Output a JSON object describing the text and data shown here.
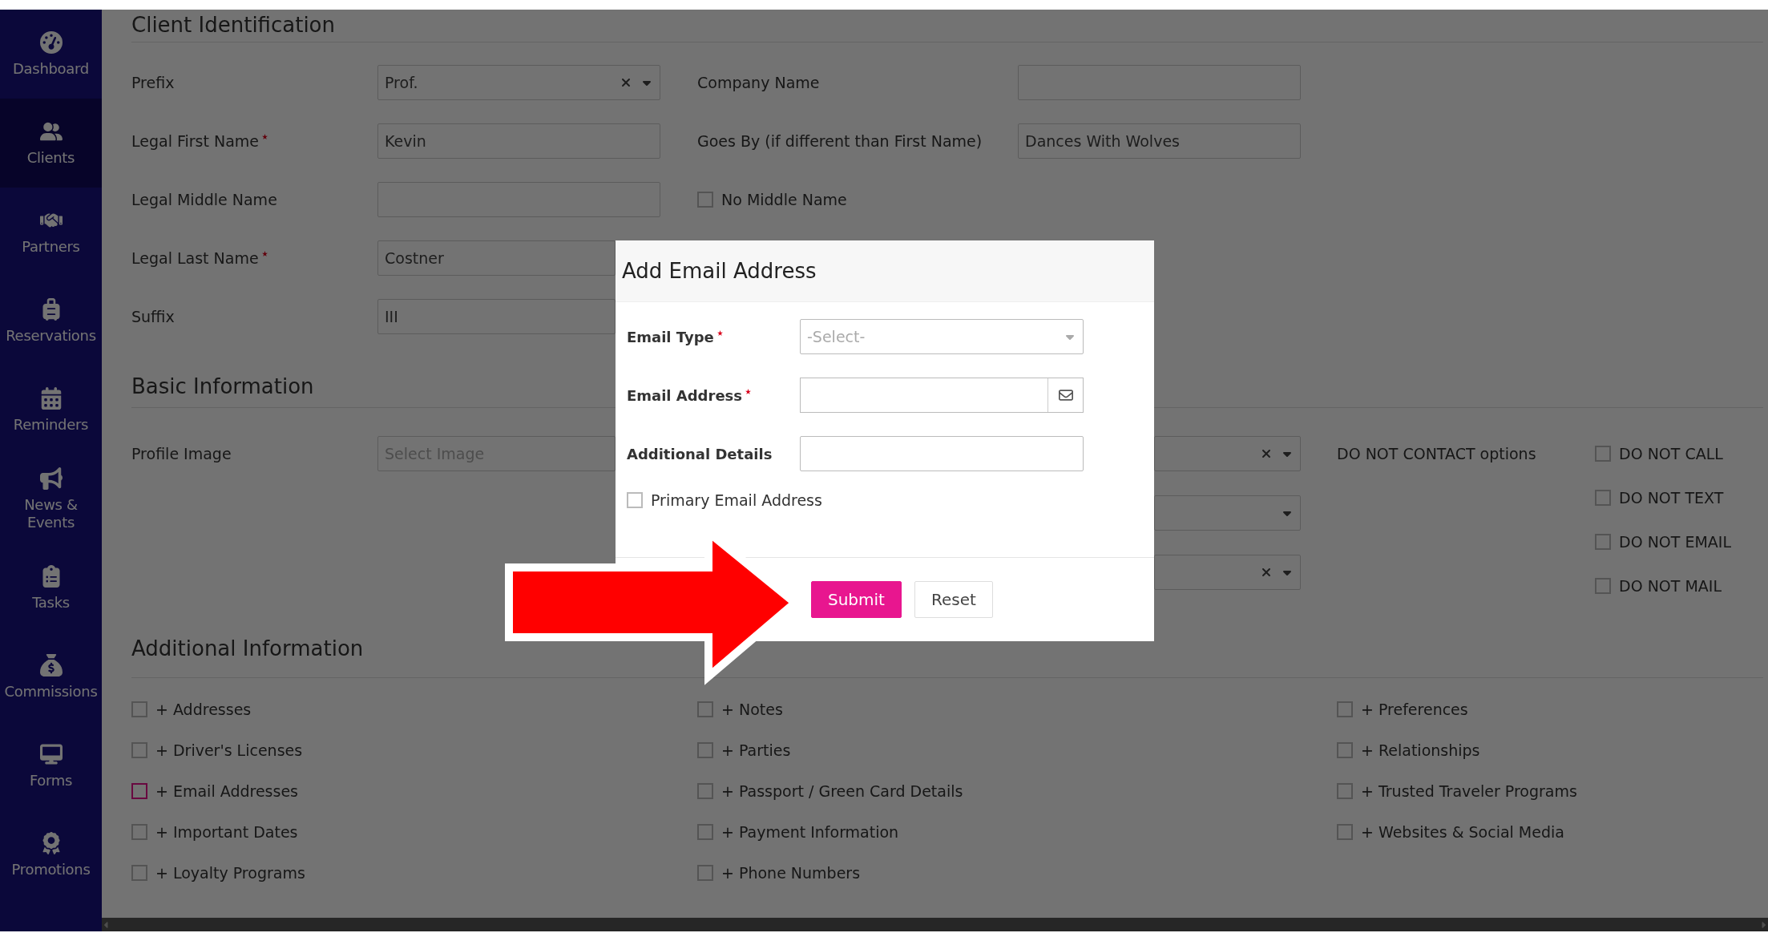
{
  "sidebar": {
    "items": [
      {
        "label": "Dashboard",
        "selected": false
      },
      {
        "label": "Clients",
        "selected": true
      },
      {
        "label": "Partners",
        "selected": false
      },
      {
        "label": "Reservations",
        "selected": false
      },
      {
        "label": "Reminders",
        "selected": false
      },
      {
        "label": "News & Events",
        "selected": false
      },
      {
        "label": "Tasks",
        "selected": false
      },
      {
        "label": "Commissions",
        "selected": false
      },
      {
        "label": "Forms",
        "selected": false
      },
      {
        "label": "Promotions",
        "selected": false
      }
    ]
  },
  "client_identification": {
    "heading": "Client Identification",
    "rows": [
      {
        "left": {
          "label": "Prefix",
          "required": false,
          "kind": "select",
          "value": "Prof.",
          "clearable": true
        },
        "right": {
          "kind": "text",
          "label": "Company Name"
        }
      },
      {
        "left": {
          "label": "Legal First Name",
          "required": true,
          "kind": "text",
          "value": "Kevin"
        },
        "right": {
          "kind": "text",
          "label": "Goes By (if different than First Name)",
          "value": "Dances With Wolves"
        }
      },
      {
        "left": {
          "label": "Legal Middle Name",
          "required": false,
          "kind": "text"
        },
        "right": {
          "kind": "checkbox",
          "label": "No Middle Name",
          "checked": false
        }
      },
      {
        "left": {
          "label": "Legal Last Name",
          "required": true,
          "kind": "text",
          "value": "Costner"
        }
      },
      {
        "left": {
          "label": "Suffix",
          "required": false,
          "kind": "text",
          "value": "III"
        }
      }
    ]
  },
  "basic_information": {
    "heading": "Basic Information",
    "profile_image": {
      "label": "Profile Image",
      "placeholder": "Select Image"
    },
    "right_selects": [
      {
        "clearable": true
      },
      {
        "clearable": false
      },
      {
        "clearable": true
      }
    ],
    "do_not_contact": {
      "label": "DO NOT CONTACT options",
      "options": [
        {
          "label": "DO NOT CALL",
          "checked": false
        },
        {
          "label": "DO NOT TEXT",
          "checked": false
        },
        {
          "label": "DO NOT EMAIL",
          "checked": false
        },
        {
          "label": "DO NOT MAIL",
          "checked": false
        }
      ]
    }
  },
  "additional_information": {
    "heading": "Additional Information",
    "columns": [
      {
        "items": [
          {
            "label": "+ Addresses",
            "checked": false,
            "color": "#545454"
          },
          {
            "label": "+ Driver's Licenses",
            "checked": false,
            "color": "#545454"
          },
          {
            "label": "+ Email Addresses",
            "checked": false,
            "color": "#680a40"
          },
          {
            "label": "+ Important Dates",
            "checked": false,
            "color": "#545454"
          },
          {
            "label": "+ Loyalty Programs",
            "checked": false,
            "color": "#545454"
          }
        ]
      },
      {
        "items": [
          {
            "label": "+ Notes",
            "checked": false,
            "color": "#545454"
          },
          {
            "label": "+ Parties",
            "checked": false,
            "color": "#545454"
          },
          {
            "label": "+ Passport / Green Card Details",
            "checked": false,
            "color": "#545454"
          },
          {
            "label": "+ Payment Information",
            "checked": false,
            "color": "#545454"
          },
          {
            "label": "+ Phone Numbers",
            "checked": false,
            "color": "#545454"
          }
        ]
      },
      {
        "items": [
          {
            "label": "+ Preferences",
            "checked": false,
            "color": "#545454"
          },
          {
            "label": "+ Relationships",
            "checked": false,
            "color": "#545454"
          },
          {
            "label": "+ Trusted Traveler Programs",
            "checked": false,
            "color": "#545454"
          },
          {
            "label": "+ Websites & Social Media",
            "checked": false,
            "color": "#545454"
          }
        ]
      }
    ]
  },
  "modal": {
    "title": "Add Email Address",
    "fields": [
      {
        "label": "Email Type",
        "required": true,
        "kind": "select",
        "placeholder": "-Select-"
      },
      {
        "label": "Email Address",
        "required": true,
        "kind": "email"
      },
      {
        "label": "Additional Details",
        "required": false,
        "kind": "text"
      }
    ],
    "primary": {
      "label": "Primary Email Address",
      "checked": false
    },
    "buttons": [
      {
        "label": "Submit",
        "kind": "primary"
      },
      {
        "label": "Reset",
        "kind": "secondary"
      }
    ]
  }
}
